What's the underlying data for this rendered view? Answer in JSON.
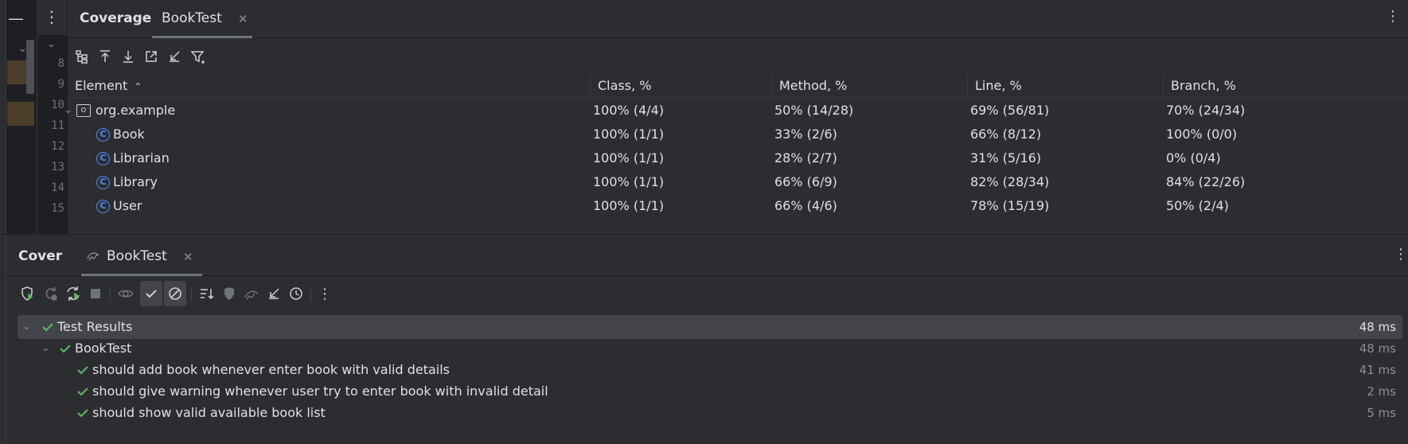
{
  "editor": {
    "line_numbers": [
      "8",
      "9",
      "10",
      "11",
      "12",
      "13",
      "14",
      "15"
    ]
  },
  "coverage_panel": {
    "title": "Coverage",
    "tab_label": "BookTest",
    "columns": [
      "Element",
      "Class, %",
      "Method, %",
      "Line, %",
      "Branch, %"
    ],
    "rows": [
      {
        "name": "org.example",
        "type": "package",
        "class": "100% (4/4)",
        "method": "50% (14/28)",
        "line": "69% (56/81)",
        "branch": "70% (24/34)"
      },
      {
        "name": "Book",
        "type": "class",
        "class": "100% (1/1)",
        "method": "33% (2/6)",
        "line": "66% (8/12)",
        "branch": "100% (0/0)"
      },
      {
        "name": "Librarian",
        "type": "class",
        "class": "100% (1/1)",
        "method": "28% (2/7)",
        "line": "31% (5/16)",
        "branch": "0% (0/4)"
      },
      {
        "name": "Library",
        "type": "class",
        "class": "100% (1/1)",
        "method": "66% (6/9)",
        "line": "82% (28/34)",
        "branch": "84% (22/26)"
      },
      {
        "name": "User",
        "type": "class",
        "class": "100% (1/1)",
        "method": "66% (4/6)",
        "line": "78% (15/19)",
        "branch": "50% (2/4)"
      }
    ],
    "class_icon_glyph": "C"
  },
  "run_panel": {
    "title": "Cover",
    "tab_label": "BookTest",
    "results": [
      {
        "label": "Test Results",
        "time": "48 ms"
      },
      {
        "label": "BookTest",
        "time": "48 ms"
      },
      {
        "label": "should add book whenever enter book with valid details",
        "time": "41 ms"
      },
      {
        "label": "should give warning whenever user try to enter book with invalid detail",
        "time": "2 ms"
      },
      {
        "label": "should show valid available book list",
        "time": "5 ms"
      }
    ]
  },
  "colors": {
    "pass_green": "#5fb865",
    "class_blue": "#548af7",
    "panel_bg": "#2b2d30",
    "selected_bg": "#43454a"
  }
}
